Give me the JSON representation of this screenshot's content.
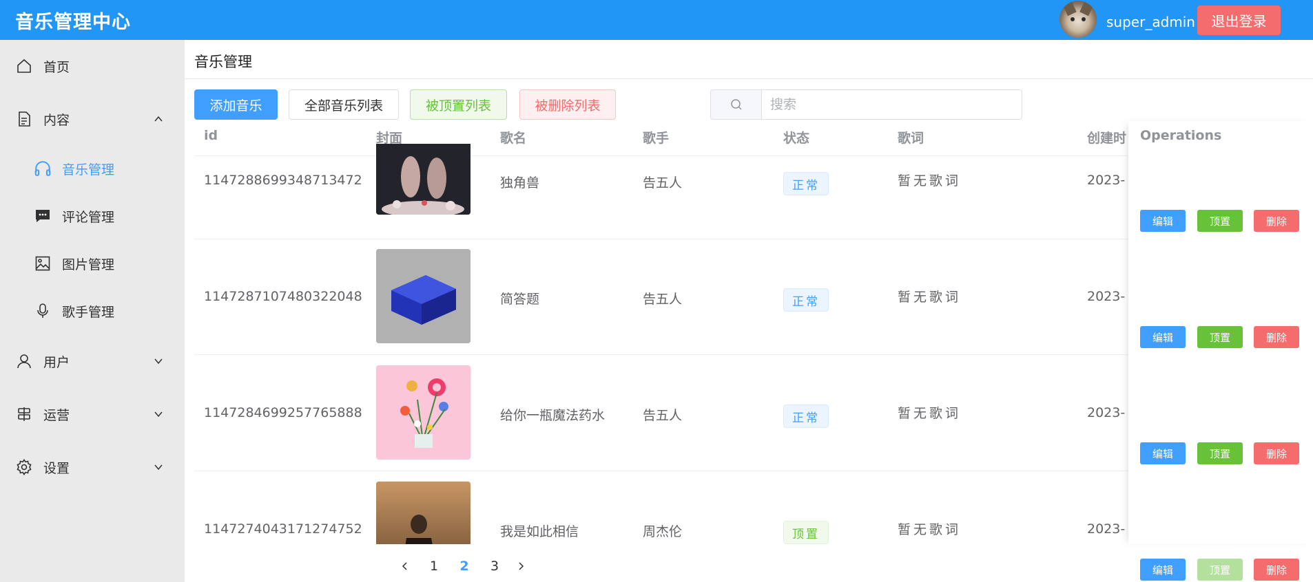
{
  "header": {
    "app_title": "音乐管理中心",
    "username": "super_admin",
    "logout_label": "退出登录"
  },
  "sidebar": {
    "items": [
      {
        "label": "首页",
        "icon": "home-icon"
      },
      {
        "label": "内容",
        "icon": "document-icon",
        "expanded": true
      },
      {
        "label": "音乐管理",
        "icon": "headphones-icon",
        "active": true
      },
      {
        "label": "评论管理",
        "icon": "comment-icon"
      },
      {
        "label": "图片管理",
        "icon": "image-icon"
      },
      {
        "label": "歌手管理",
        "icon": "microphone-icon"
      },
      {
        "label": "用户",
        "icon": "user-icon"
      },
      {
        "label": "运营",
        "icon": "signpost-icon"
      },
      {
        "label": "设置",
        "icon": "gear-icon"
      }
    ]
  },
  "main": {
    "title": "音乐管理",
    "toolbar": {
      "add": "添加音乐",
      "all": "全部音乐列表",
      "top": "被顶置列表",
      "deleted": "被删除列表"
    },
    "search": {
      "placeholder": "搜索",
      "value": ""
    },
    "table": {
      "columns": [
        "id",
        "封面",
        "歌名",
        "歌手",
        "状态",
        "歌词",
        "创建时"
      ],
      "ops_column": "Operations",
      "rows": [
        {
          "id": "1147288699348713472",
          "name": "独角兽",
          "singer": "告五人",
          "status": "正常",
          "lyric": "暂无歌词",
          "created": "2023-",
          "edit": "编辑",
          "top": "顶置",
          "delete": "删除",
          "top_disabled": false
        },
        {
          "id": "1147287107480322048",
          "name": "简答题",
          "singer": "告五人",
          "status": "正常",
          "lyric": "暂无歌词",
          "created": "2023-",
          "edit": "编辑",
          "top": "顶置",
          "delete": "删除",
          "top_disabled": false
        },
        {
          "id": "1147284699257765888",
          "name": "给你一瓶魔法药水",
          "singer": "告五人",
          "status": "正常",
          "lyric": "暂无歌词",
          "created": "2023-",
          "edit": "编辑",
          "top": "顶置",
          "delete": "删除",
          "top_disabled": false
        },
        {
          "id": "1147274043171274752",
          "name": "我是如此相信",
          "singer": "周杰伦",
          "status": "顶置",
          "lyric": "暂无歌词",
          "created": "2023-",
          "edit": "编辑",
          "top": "顶置",
          "delete": "删除",
          "top_disabled": true
        }
      ]
    },
    "pagination": {
      "pages": [
        "1",
        "2",
        "3"
      ],
      "current": "2"
    }
  },
  "colors": {
    "primary": "#409eff",
    "header": "#2196f7",
    "success": "#67c23a",
    "danger": "#f56c6c"
  }
}
